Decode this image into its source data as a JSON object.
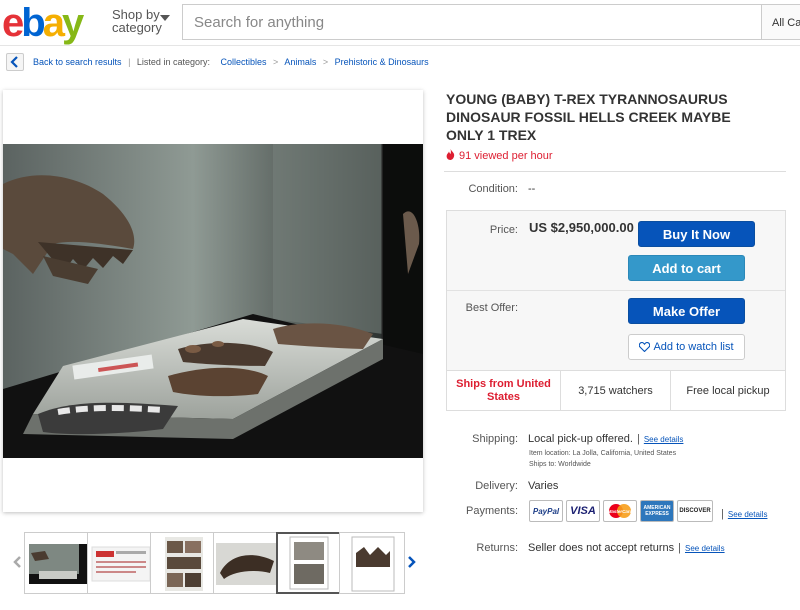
{
  "header": {
    "logo": {
      "e": "e",
      "b": "b",
      "a": "a",
      "y": "y"
    },
    "shop_by_line1": "Shop by",
    "shop_by_line2": "category",
    "search_placeholder": "Search for anything",
    "all_categories": "All Categories"
  },
  "breadcrumb": {
    "back": "Back to search results",
    "listed_in": "Listed in category:",
    "categories": [
      "Collectibles",
      "Animals",
      "Prehistoric & Dinosaurs"
    ],
    "separator": ">"
  },
  "listing": {
    "title": "YOUNG (BABY) T-REX TYRANNOSAURUS DINOSAUR FOSSIL HELLS CREEK MAYBE ONLY 1 TREX",
    "viewed": "91 viewed per hour",
    "condition_label": "Condition:",
    "condition_value": "--",
    "price_label": "Price:",
    "price_value": "US $2,950,000.00",
    "buy_now": "Buy It Now",
    "add_to_cart": "Add to cart",
    "best_offer_label": "Best Offer:",
    "make_offer": "Make Offer",
    "watch_list": "Add to watch list",
    "ships_from": "Ships from United States",
    "watchers": "3,715 watchers",
    "pickup": "Free local pickup",
    "shipping_label": "Shipping:",
    "shipping_value": "Local pick-up offered.",
    "see_details": "See details",
    "item_location": "Item location:  La Jolla, California, United States",
    "ships_to": "Ships to:  Worldwide",
    "delivery_label": "Delivery:",
    "delivery_value": "Varies",
    "payments_label": "Payments:",
    "payment_methods": [
      "PayPal",
      "VISA",
      "MasterCard",
      "AMERICAN EXPRESS",
      "DISCOVER"
    ],
    "returns_label": "Returns:",
    "returns_value": "Seller does not accept returns"
  },
  "colors": {
    "link": "#0654ba",
    "buy_button": "#0654ba",
    "cart_button": "#3498ca",
    "alert_red": "#dd1e31"
  },
  "icons": [
    "back-arrow-icon",
    "flame-icon",
    "heart-icon",
    "chevron-left-icon",
    "chevron-right-icon",
    "caret-down-icon"
  ]
}
